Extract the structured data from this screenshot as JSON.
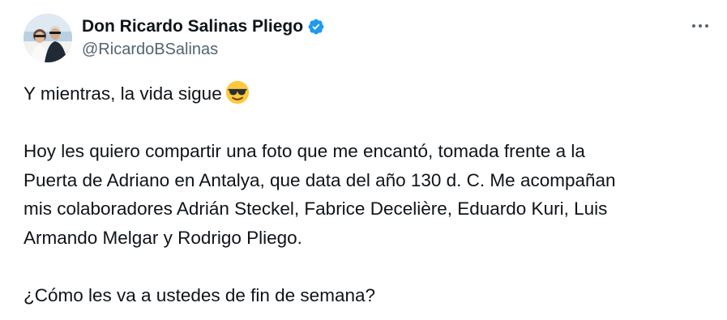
{
  "tweet": {
    "display_name": "Don Ricardo Salinas Pliego",
    "handle": "@RicardoBSalinas",
    "colors": {
      "text": "#0f1419",
      "secondary": "#536471",
      "verified": "#1d9bf0",
      "emoji": "#ffc83d"
    },
    "icons": {
      "verified": "verified-badge-icon",
      "more": "more-options-icon",
      "emoji": "smiling-face-with-sunglasses-emoji"
    },
    "body": {
      "line1": "Y mientras, la vida sigue",
      "line2": "Hoy les quiero compartir una foto que me encantó, tomada frente a la",
      "line3": "Puerta de Adriano en Antalya, que data del año 130 d. C. Me acompañan",
      "line4": "mis colaboradores Adrián Steckel, Fabrice Decelière, Eduardo Kuri, Luis",
      "line5": "Armando Melgar y Rodrigo Pliego.",
      "line6": "¿Cómo les va a ustedes de fin de semana?"
    }
  }
}
